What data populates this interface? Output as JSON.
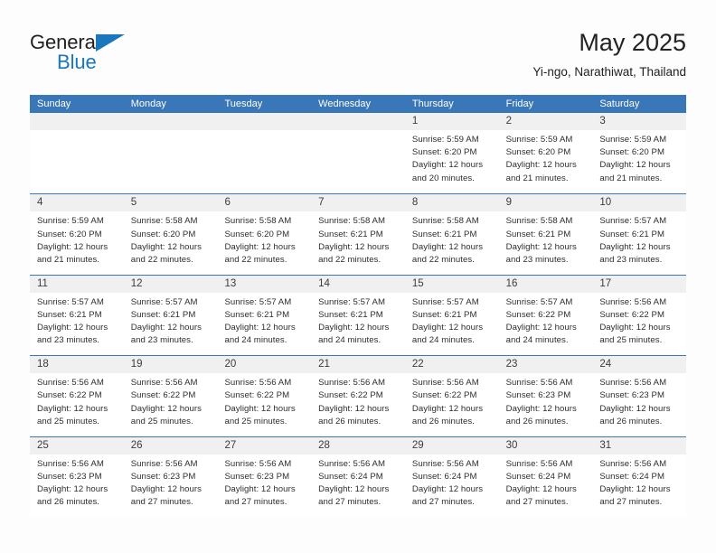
{
  "brand": {
    "word1": "General",
    "word2": "Blue",
    "triangle_color": "#1a77bd",
    "text_color": "#231f20"
  },
  "header": {
    "title": "May 2025",
    "subtitle": "Yi-ngo, Narathiwat, Thailand"
  },
  "theme": {
    "header_bar_color": "#3a77b8",
    "day_band_color": "#f0f0f0",
    "row_divider_color": "#3a77b8",
    "page_background": "#fdfdfd"
  },
  "calendar": {
    "weekdays": [
      "Sunday",
      "Monday",
      "Tuesday",
      "Wednesday",
      "Thursday",
      "Friday",
      "Saturday"
    ],
    "weeks": [
      [
        {
          "day": "",
          "lines": []
        },
        {
          "day": "",
          "lines": []
        },
        {
          "day": "",
          "lines": []
        },
        {
          "day": "",
          "lines": []
        },
        {
          "day": "1",
          "lines": [
            "Sunrise: 5:59 AM",
            "Sunset: 6:20 PM",
            "Daylight: 12 hours",
            "and 20 minutes."
          ]
        },
        {
          "day": "2",
          "lines": [
            "Sunrise: 5:59 AM",
            "Sunset: 6:20 PM",
            "Daylight: 12 hours",
            "and 21 minutes."
          ]
        },
        {
          "day": "3",
          "lines": [
            "Sunrise: 5:59 AM",
            "Sunset: 6:20 PM",
            "Daylight: 12 hours",
            "and 21 minutes."
          ]
        }
      ],
      [
        {
          "day": "4",
          "lines": [
            "Sunrise: 5:59 AM",
            "Sunset: 6:20 PM",
            "Daylight: 12 hours",
            "and 21 minutes."
          ]
        },
        {
          "day": "5",
          "lines": [
            "Sunrise: 5:58 AM",
            "Sunset: 6:20 PM",
            "Daylight: 12 hours",
            "and 22 minutes."
          ]
        },
        {
          "day": "6",
          "lines": [
            "Sunrise: 5:58 AM",
            "Sunset: 6:20 PM",
            "Daylight: 12 hours",
            "and 22 minutes."
          ]
        },
        {
          "day": "7",
          "lines": [
            "Sunrise: 5:58 AM",
            "Sunset: 6:21 PM",
            "Daylight: 12 hours",
            "and 22 minutes."
          ]
        },
        {
          "day": "8",
          "lines": [
            "Sunrise: 5:58 AM",
            "Sunset: 6:21 PM",
            "Daylight: 12 hours",
            "and 22 minutes."
          ]
        },
        {
          "day": "9",
          "lines": [
            "Sunrise: 5:58 AM",
            "Sunset: 6:21 PM",
            "Daylight: 12 hours",
            "and 23 minutes."
          ]
        },
        {
          "day": "10",
          "lines": [
            "Sunrise: 5:57 AM",
            "Sunset: 6:21 PM",
            "Daylight: 12 hours",
            "and 23 minutes."
          ]
        }
      ],
      [
        {
          "day": "11",
          "lines": [
            "Sunrise: 5:57 AM",
            "Sunset: 6:21 PM",
            "Daylight: 12 hours",
            "and 23 minutes."
          ]
        },
        {
          "day": "12",
          "lines": [
            "Sunrise: 5:57 AM",
            "Sunset: 6:21 PM",
            "Daylight: 12 hours",
            "and 23 minutes."
          ]
        },
        {
          "day": "13",
          "lines": [
            "Sunrise: 5:57 AM",
            "Sunset: 6:21 PM",
            "Daylight: 12 hours",
            "and 24 minutes."
          ]
        },
        {
          "day": "14",
          "lines": [
            "Sunrise: 5:57 AM",
            "Sunset: 6:21 PM",
            "Daylight: 12 hours",
            "and 24 minutes."
          ]
        },
        {
          "day": "15",
          "lines": [
            "Sunrise: 5:57 AM",
            "Sunset: 6:21 PM",
            "Daylight: 12 hours",
            "and 24 minutes."
          ]
        },
        {
          "day": "16",
          "lines": [
            "Sunrise: 5:57 AM",
            "Sunset: 6:22 PM",
            "Daylight: 12 hours",
            "and 24 minutes."
          ]
        },
        {
          "day": "17",
          "lines": [
            "Sunrise: 5:56 AM",
            "Sunset: 6:22 PM",
            "Daylight: 12 hours",
            "and 25 minutes."
          ]
        }
      ],
      [
        {
          "day": "18",
          "lines": [
            "Sunrise: 5:56 AM",
            "Sunset: 6:22 PM",
            "Daylight: 12 hours",
            "and 25 minutes."
          ]
        },
        {
          "day": "19",
          "lines": [
            "Sunrise: 5:56 AM",
            "Sunset: 6:22 PM",
            "Daylight: 12 hours",
            "and 25 minutes."
          ]
        },
        {
          "day": "20",
          "lines": [
            "Sunrise: 5:56 AM",
            "Sunset: 6:22 PM",
            "Daylight: 12 hours",
            "and 25 minutes."
          ]
        },
        {
          "day": "21",
          "lines": [
            "Sunrise: 5:56 AM",
            "Sunset: 6:22 PM",
            "Daylight: 12 hours",
            "and 26 minutes."
          ]
        },
        {
          "day": "22",
          "lines": [
            "Sunrise: 5:56 AM",
            "Sunset: 6:22 PM",
            "Daylight: 12 hours",
            "and 26 minutes."
          ]
        },
        {
          "day": "23",
          "lines": [
            "Sunrise: 5:56 AM",
            "Sunset: 6:23 PM",
            "Daylight: 12 hours",
            "and 26 minutes."
          ]
        },
        {
          "day": "24",
          "lines": [
            "Sunrise: 5:56 AM",
            "Sunset: 6:23 PM",
            "Daylight: 12 hours",
            "and 26 minutes."
          ]
        }
      ],
      [
        {
          "day": "25",
          "lines": [
            "Sunrise: 5:56 AM",
            "Sunset: 6:23 PM",
            "Daylight: 12 hours",
            "and 26 minutes."
          ]
        },
        {
          "day": "26",
          "lines": [
            "Sunrise: 5:56 AM",
            "Sunset: 6:23 PM",
            "Daylight: 12 hours",
            "and 27 minutes."
          ]
        },
        {
          "day": "27",
          "lines": [
            "Sunrise: 5:56 AM",
            "Sunset: 6:23 PM",
            "Daylight: 12 hours",
            "and 27 minutes."
          ]
        },
        {
          "day": "28",
          "lines": [
            "Sunrise: 5:56 AM",
            "Sunset: 6:24 PM",
            "Daylight: 12 hours",
            "and 27 minutes."
          ]
        },
        {
          "day": "29",
          "lines": [
            "Sunrise: 5:56 AM",
            "Sunset: 6:24 PM",
            "Daylight: 12 hours",
            "and 27 minutes."
          ]
        },
        {
          "day": "30",
          "lines": [
            "Sunrise: 5:56 AM",
            "Sunset: 6:24 PM",
            "Daylight: 12 hours",
            "and 27 minutes."
          ]
        },
        {
          "day": "31",
          "lines": [
            "Sunrise: 5:56 AM",
            "Sunset: 6:24 PM",
            "Daylight: 12 hours",
            "and 27 minutes."
          ]
        }
      ]
    ]
  }
}
